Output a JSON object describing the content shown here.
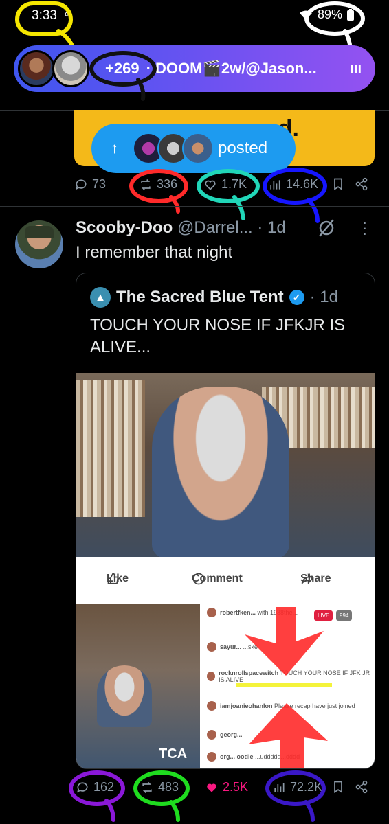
{
  "status_bar": {
    "time": "3:33",
    "notif_icons": "∞",
    "battery": "89%"
  },
  "spaces_bar": {
    "listener_count": "+269",
    "separator": "·",
    "title": "DOOM🎬2w/@Jason...",
    "bars": "ııı"
  },
  "previous_tweet": {
    "card_tail": "d.",
    "posted_label": "posted",
    "replies": "73",
    "reposts": "336",
    "likes": "1.7K",
    "views": "14.6K"
  },
  "tweet": {
    "name": "Scooby-Doo",
    "handle": "@Darrel...",
    "time": "· 1d",
    "text": "I remember that night",
    "quote": {
      "name": "The Sacred Blue Tent",
      "time": "· 1d",
      "text": "TOUCH YOUR NOSE IF JFKJR IS ALIVE...",
      "fb_like": "Like",
      "fb_comment": "Comment",
      "fb_share": "Share",
      "live_label": "LIVE",
      "viewers": "994",
      "comments": [
        {
          "user": "robertfken...",
          "text": "with 1988the..."
        },
        {
          "user": "sayur...",
          "text": "...ske"
        },
        {
          "user": "rocknrollspacewitch",
          "text": "TOUCH YOUR NOSE IF JFK JR IS ALIVE"
        },
        {
          "user": "iamjoanieohanlon",
          "text": "Please recap have just joined"
        },
        {
          "user": "georg...",
          "text": ""
        },
        {
          "user": "org... oodie",
          "text": "...uddddd...dddd"
        }
      ],
      "sign_fragment": "TCA"
    },
    "replies": "162",
    "reposts": "483",
    "likes": "2.5K",
    "views": "72.2K"
  },
  "colors": {
    "accent": "#1d9bf0",
    "like_active": "#f91880",
    "muted": "#8b98a5",
    "annotation_yellow": "#f5e600",
    "annotation_red": "#ff2a2a",
    "annotation_teal": "#21d6b8",
    "annotation_blue": "#1616ff",
    "annotation_purple": "#8a18d8",
    "annotation_green": "#1fdc1f"
  }
}
